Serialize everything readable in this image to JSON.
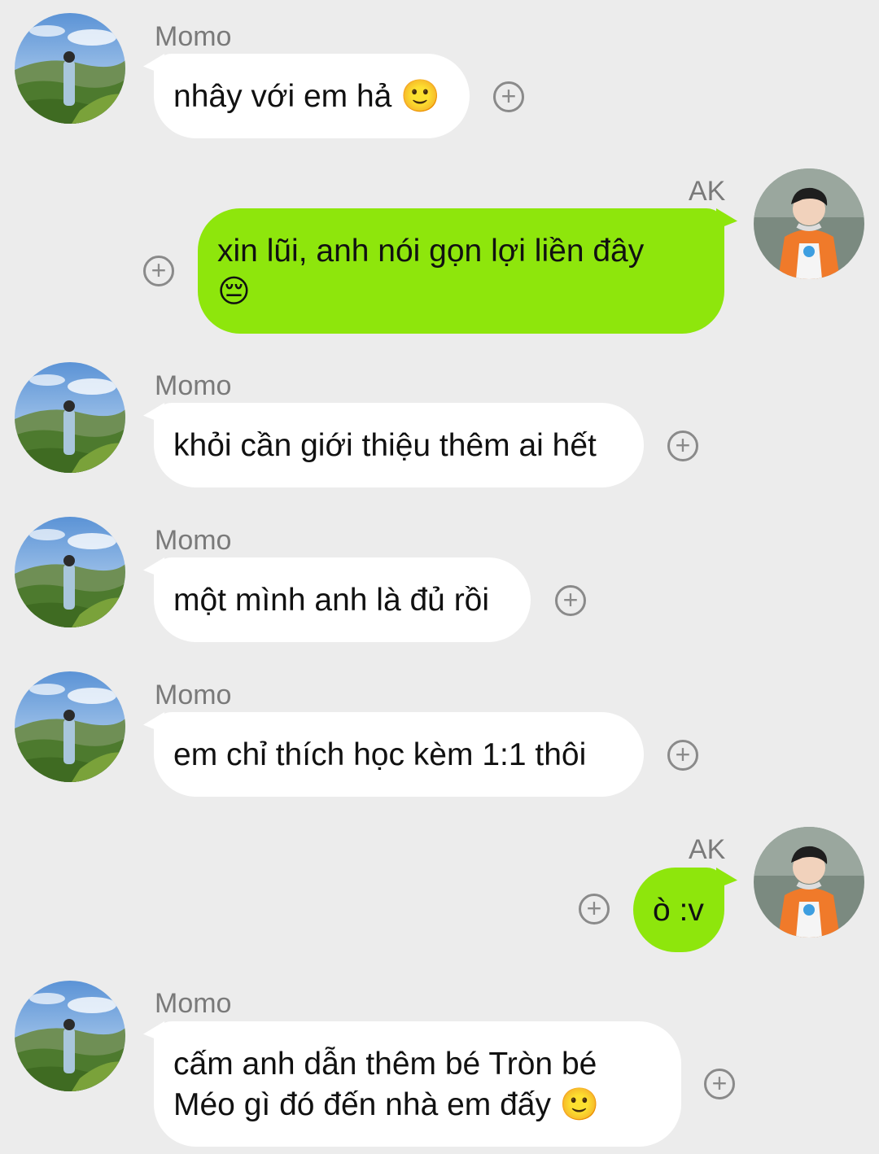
{
  "colors": {
    "background": "#ececec",
    "incoming_bubble": "#ffffff",
    "outgoing_bubble": "#8ee60c",
    "sender_name": "#7a7a7a",
    "react_icon": "#8a8a8a"
  },
  "messages": [
    {
      "sender": "Momo",
      "text": "nhây với em hả 🙂",
      "direction": "incoming",
      "react_icon": "add-reaction-icon"
    },
    {
      "sender": "AK",
      "text": "xin lũi, anh nói gọn lợi liền đây\n😔",
      "direction": "outgoing",
      "react_icon": "add-reaction-icon"
    },
    {
      "sender": "Momo",
      "text": "khỏi cần giới thiệu thêm ai hết",
      "direction": "incoming",
      "react_icon": "add-reaction-icon"
    },
    {
      "sender": "Momo",
      "text": "một mình anh là đủ rồi",
      "direction": "incoming",
      "react_icon": "add-reaction-icon"
    },
    {
      "sender": "Momo",
      "text": "em chỉ thích học kèm 1:1 thôi",
      "direction": "incoming",
      "react_icon": "add-reaction-icon"
    },
    {
      "sender": "AK",
      "text": "ò :v",
      "direction": "outgoing",
      "react_icon": "add-reaction-icon"
    },
    {
      "sender": "Momo",
      "text": "cấm anh dẫn thêm bé Tròn bé\nMéo gì đó đến nhà em đấy 🙂",
      "direction": "incoming",
      "react_icon": "add-reaction-icon"
    }
  ]
}
